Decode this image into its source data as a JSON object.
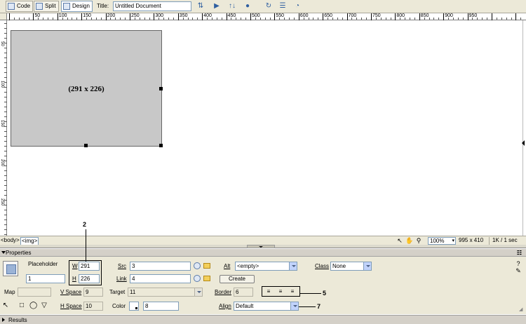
{
  "toolbar": {
    "code_label": "Code",
    "split_label": "Split",
    "design_label": "Design",
    "title_label": "Title:",
    "title_value": "Untitled Document",
    "icons": [
      "file-management-icon",
      "preview-icon",
      "debug-icon",
      "visual-aids-icon",
      "refresh-icon",
      "view-options-icon",
      "check-page-icon"
    ]
  },
  "ruler": {
    "labels": [
      "50",
      "100",
      "150",
      "200",
      "250",
      "300",
      "350",
      "400",
      "450",
      "500",
      "550",
      "600",
      "650",
      "700",
      "750",
      "800",
      "850",
      "900",
      "950"
    ],
    "vertical_labels": [
      "50",
      "100",
      "150",
      "200",
      "250"
    ]
  },
  "canvas": {
    "placeholder_text": "(291 x 226)"
  },
  "statusbar": {
    "tags": [
      "<body>",
      "<img>"
    ],
    "zoom": "100%",
    "window_size": "995 x 410",
    "download": "1K / 1 sec"
  },
  "properties": {
    "header": "Properties",
    "placeholder_label": "Placeholder",
    "name_value": "1",
    "w_label": "W",
    "w_value": "291",
    "h_label": "H",
    "h_value": "226",
    "src_label": "Src",
    "src_value": "3",
    "link_label": "Link",
    "link_value": "4",
    "alt_label": "Alt",
    "alt_value": "<empty>",
    "create_label": "Create",
    "class_label": "Class",
    "class_value": "None",
    "map_label": "Map",
    "vspace_label": "V Space",
    "vspace_value": "9",
    "target_label": "Target",
    "target_value": "11",
    "border_label": "Border",
    "border_value": "6",
    "hspace_label": "H Space",
    "hspace_value": "10",
    "color_label": "Color",
    "color_value": "8",
    "align_label": "Align",
    "align_value": "Default"
  },
  "callouts": {
    "c2": "2",
    "c5": "5",
    "c7": "7"
  },
  "results": {
    "label": "Results"
  }
}
